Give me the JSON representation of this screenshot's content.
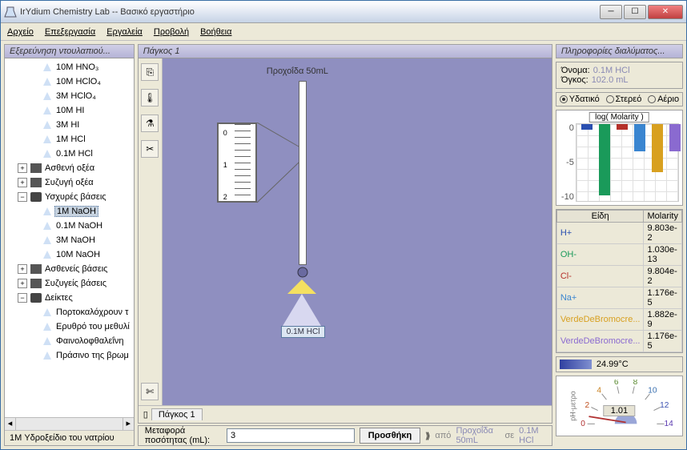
{
  "window": {
    "title": "IrYdium Chemistry Lab -- Βασικό εργαστήριο"
  },
  "menu": {
    "file": "Αρχείο",
    "edit": "Επεξεργασία",
    "tools": "Εργαλεία",
    "view": "Προβολή",
    "help": "Βοήθεια"
  },
  "cabinet": {
    "title": "Εξερεύνηση ντουλαπιού...",
    "items": [
      "10M HNO₃",
      "10M HClO₄",
      "3M HClO₄",
      "10M HI",
      "3M HI",
      "1M HCl",
      "0.1M HCl"
    ],
    "cats": {
      "weak_acids": "Ασθενή οξέα",
      "conj_acids": "Συζυγή οξέα",
      "strong_bases": "Υσχυρές βάσεις",
      "weak_bases": "Ασθενείς βάσεις",
      "conj_bases": "Συζυγείς βάσεις",
      "indicators": "Δείκτες"
    },
    "bases": [
      "1M NaOH",
      "0.1M NaOH",
      "3M NaOH",
      "10M NaOH"
    ],
    "indicators": [
      "Πορτοκαλόχρουν τ",
      "Ερυθρό του μεθυλί",
      "Φαινολοφθαλεΐνη",
      "Πράσινο της βρωμ"
    ],
    "status": "1M Υδροξείδιο του νατρίου",
    "selected": "1M NaOH"
  },
  "bench": {
    "title": "Πάγκος 1",
    "tab": "Πάγκος 1",
    "burette_label": "Προχοΐδα 50mL",
    "flask_label": "0.1M HCl"
  },
  "transfer": {
    "label": "Μεταφορά ποσότητας (mL):",
    "value": "3",
    "button": "Προσθήκη",
    "from_word": "από",
    "from": "Προχοΐδα 50mL",
    "to_word": "σε",
    "to": "0.1M HCl"
  },
  "info": {
    "title": "Πληροφορίες διαλύματος...",
    "name_label": "Όνομα:",
    "name": "0.1M HCl",
    "vol_label": "Όγκος:",
    "vol": "102.0 mL",
    "radios": {
      "aqueous": "Υδατικό",
      "solid": "Στερεό",
      "gas": "Αέριο"
    }
  },
  "chart_data": {
    "type": "bar",
    "title": "log( Molarity )",
    "yticks": [
      "0",
      "-5",
      "-10"
    ],
    "series": [
      {
        "name": "H+",
        "value": -1.0,
        "color": "#2a4fb0"
      },
      {
        "name": "OH-",
        "value": -13.0,
        "color": "#1a9a5a"
      },
      {
        "name": "Cl-",
        "value": -1.0,
        "color": "#b5302a"
      },
      {
        "name": "Na+",
        "value": -4.9,
        "color": "#3a85d0"
      },
      {
        "name": "VerdeDeBromocre1",
        "value": -8.7,
        "color": "#d8a020"
      },
      {
        "name": "VerdeDeBromocre2",
        "value": -4.9,
        "color": "#8a6ad0"
      }
    ],
    "ylim": [
      -14,
      0
    ]
  },
  "species": {
    "headers": {
      "name": "Είδη",
      "mol": "Molarity"
    },
    "rows": [
      {
        "name": "H+",
        "mol": "9.803e-2",
        "color": "#2a4fb0"
      },
      {
        "name": "OH-",
        "mol": "1.030e-13",
        "color": "#1a9a5a"
      },
      {
        "name": "Cl-",
        "mol": "9.804e-2",
        "color": "#b5302a"
      },
      {
        "name": "Na+",
        "mol": "1.176e-5",
        "color": "#3a85d0"
      },
      {
        "name": "VerdeDeBromocre...",
        "mol": "1.882e-9",
        "color": "#d8a020"
      },
      {
        "name": "VerdeDeBromocre...",
        "mol": "1.176e-5",
        "color": "#8a6ad0"
      }
    ]
  },
  "temperature": "24.99°C",
  "ph": {
    "label": "pH-μετρο",
    "value": "1.01",
    "ticks": [
      "0",
      "2",
      "4",
      "6",
      "8",
      "10",
      "12",
      "14"
    ]
  }
}
